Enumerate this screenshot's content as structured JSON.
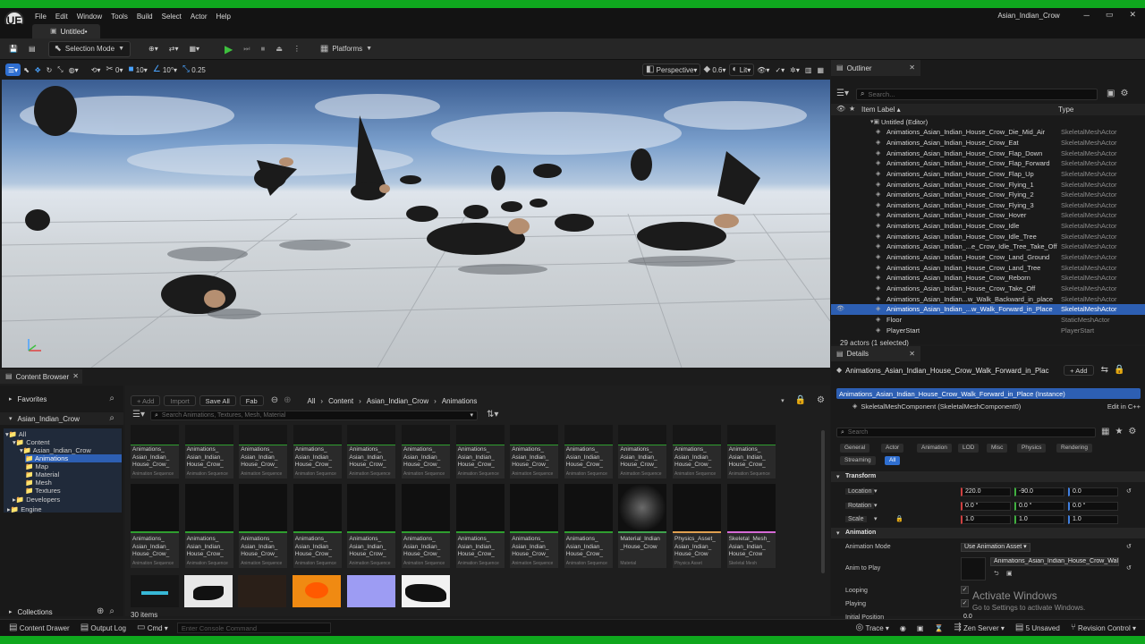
{
  "window": {
    "title": "Asian_Indian_Crow",
    "logo": "UE",
    "minimize": "─",
    "maximize": "▭",
    "close": "✕"
  },
  "menu": [
    "File",
    "Edit",
    "Window",
    "Tools",
    "Build",
    "Select",
    "Actor",
    "Help"
  ],
  "doc_tab": "Untitled•",
  "toolbar": {
    "selection_mode": "Selection Mode",
    "platforms": "Platforms"
  },
  "viewport_toolbar": {
    "rot_snap": "0",
    "grid_snap": "10",
    "angle_snap": "10°",
    "scale_snap": "0.25",
    "perspective": "Perspective",
    "fov": "0.6",
    "lit": "Lit"
  },
  "outliner": {
    "tab": "Outliner",
    "search_placeholder": "Search...",
    "col_label": "Item Label ▴",
    "col_type": "Type",
    "root": "Untitled (Editor)",
    "rows": [
      {
        "name": "Animations_Asian_Indian_House_Crow_Die_Mid_Air",
        "type": "SkeletalMeshActor"
      },
      {
        "name": "Animations_Asian_Indian_House_Crow_Eat",
        "type": "SkeletalMeshActor"
      },
      {
        "name": "Animations_Asian_Indian_House_Crow_Flap_Down",
        "type": "SkeletalMeshActor"
      },
      {
        "name": "Animations_Asian_Indian_House_Crow_Flap_Forward",
        "type": "SkeletalMeshActor"
      },
      {
        "name": "Animations_Asian_Indian_House_Crow_Flap_Up",
        "type": "SkeletalMeshActor"
      },
      {
        "name": "Animations_Asian_Indian_House_Crow_Flying_1",
        "type": "SkeletalMeshActor"
      },
      {
        "name": "Animations_Asian_Indian_House_Crow_Flying_2",
        "type": "SkeletalMeshActor"
      },
      {
        "name": "Animations_Asian_Indian_House_Crow_Flying_3",
        "type": "SkeletalMeshActor"
      },
      {
        "name": "Animations_Asian_Indian_House_Crow_Hover",
        "type": "SkeletalMeshActor"
      },
      {
        "name": "Animations_Asian_Indian_House_Crow_Idle",
        "type": "SkeletalMeshActor"
      },
      {
        "name": "Animations_Asian_Indian_House_Crow_Idle_Tree",
        "type": "SkeletalMeshActor"
      },
      {
        "name": "Animations_Asian_Indian_...e_Crow_Idle_Tree_Take_Off",
        "type": "SkeletalMeshActor"
      },
      {
        "name": "Animations_Asian_Indian_House_Crow_Land_Ground",
        "type": "SkeletalMeshActor"
      },
      {
        "name": "Animations_Asian_Indian_House_Crow_Land_Tree",
        "type": "SkeletalMeshActor"
      },
      {
        "name": "Animations_Asian_Indian_House_Crow_Reborn",
        "type": "SkeletalMeshActor"
      },
      {
        "name": "Animations_Asian_Indian_House_Crow_Take_Off",
        "type": "SkeletalMeshActor"
      },
      {
        "name": "Animations_Asian_Indian...w_Walk_Backward_in_place",
        "type": "SkeletalMeshActor"
      },
      {
        "name": "Animations_Asian_Indian_...w_Walk_Forward_in_Place",
        "type": "SkeletalMeshActor",
        "selected": true
      },
      {
        "name": "Floor",
        "type": "StaticMeshActor"
      },
      {
        "name": "PlayerStart",
        "type": "PlayerStart"
      }
    ],
    "footer": "29 actors (1 selected)"
  },
  "details": {
    "tab": "Details",
    "actor_name": "Animations_Asian_Indian_House_Crow_Walk_Forward_in_Plac",
    "add_label": "+ Add",
    "instance": "Animations_Asian_Indian_House_Crow_Walk_Forward_in_Place (Instance)",
    "component": "SkeletalMeshComponent (SkeletalMeshComponent0)",
    "edit_cpp": "Edit in C++",
    "search_placeholder": "Search",
    "categories": [
      "General",
      "Actor",
      "Animation",
      "LOD",
      "Misc",
      "Physics",
      "Rendering",
      "Streaming",
      "All"
    ],
    "transform": {
      "header": "Transform",
      "location_label": "Location",
      "location": [
        "220.0",
        "-90.0",
        "0.0"
      ],
      "rotation_label": "Rotation",
      "rotation": [
        "0.0 °",
        "0.0 °",
        "0.0 °"
      ],
      "scale_label": "Scale",
      "scale": [
        "1.0",
        "1.0",
        "1.0"
      ]
    },
    "animation": {
      "header": "Animation",
      "mode_label": "Animation Mode",
      "mode_value": "Use Animation Asset",
      "anim_label": "Anim to Play",
      "anim_value": "Animations_Asian_Indian_House_Crow_Wal",
      "looping_label": "Looping",
      "playing_label": "Playing",
      "initial_label": "Initial Position",
      "initial_value": "0.0"
    },
    "activate_title": "Activate Windows",
    "activate_sub": "Go to Settings to activate Windows."
  },
  "content_browser": {
    "tab": "Content Browser",
    "favorites": "Favorites",
    "project": "Asian_Indian_Crow",
    "add": "+ Add",
    "import": "Import",
    "save_all": "Save All",
    "fab": "Fab",
    "path": [
      "All",
      "Content",
      "Asian_Indian_Crow",
      "Animations"
    ],
    "search_placeholder": "Search Animations, Textures, Mesh, Material",
    "tree": [
      "All",
      "Content",
      "Asian_Indian_Crow",
      "Animations",
      "Map",
      "Material",
      "Mesh",
      "Textures",
      "Developers",
      "Engine"
    ],
    "collections": "Collections",
    "item_count": "30 items",
    "row1": [
      {
        "name": "Animations_ Asian_Indian_ House_Crow_",
        "type": "Animation Sequence"
      },
      {
        "name": "Animations_ Asian_Indian_ House_Crow_",
        "type": "Animation Sequence"
      },
      {
        "name": "Animations_ Asian_Indian_ House_Crow_",
        "type": "Animation Sequence"
      },
      {
        "name": "Animations_ Asian_Indian_ House_Crow_",
        "type": "Animation Sequence"
      },
      {
        "name": "Animations_ Asian_Indian_ House_Crow_",
        "type": "Animation Sequence"
      },
      {
        "name": "Animations_ Asian_Indian_ House_Crow_",
        "type": "Animation Sequence"
      },
      {
        "name": "Animations_ Asian_Indian_ House_Crow_",
        "type": "Animation Sequence"
      },
      {
        "name": "Animations_ Asian_Indian_ House_Crow_",
        "type": "Animation Sequence"
      },
      {
        "name": "Animations_ Asian_Indian_ House_Crow_",
        "type": "Animation Sequence"
      },
      {
        "name": "Animations_ Asian_Indian_ House_Crow_",
        "type": "Animation Sequence"
      },
      {
        "name": "Animations_ Asian_Indian_ House_Crow_",
        "type": "Animation Sequence"
      },
      {
        "name": "Animations_ Asian_Indian_ House_Crow_",
        "type": "Animation Sequence"
      }
    ],
    "row2": [
      {
        "name": "Animations_ Asian_Indian_ House_Crow_",
        "type": "Animation Sequence",
        "bar": "#2f9e2f"
      },
      {
        "name": "Animations_ Asian_Indian_ House_Crow_",
        "type": "Animation Sequence",
        "bar": "#2f9e2f"
      },
      {
        "name": "Animations_ Asian_Indian_ House_Crow_",
        "type": "Animation Sequence",
        "bar": "#2f9e2f"
      },
      {
        "name": "Animations_ Asian_Indian_ House_Crow_",
        "type": "Animation Sequence",
        "bar": "#2f9e2f"
      },
      {
        "name": "Animations_ Asian_Indian_ House_Crow_",
        "type": "Animation Sequence",
        "bar": "#2f9e2f"
      },
      {
        "name": "Animations_ Asian_Indian_ House_Crow_",
        "type": "Animation Sequence",
        "bar": "#2f9e2f"
      },
      {
        "name": "Animations_ Asian_Indian_ House_Crow_",
        "type": "Animation Sequence",
        "bar": "#2f9e2f"
      },
      {
        "name": "Animations_ Asian_Indian_ House_Crow_",
        "type": "Animation Sequence",
        "bar": "#2f9e2f"
      },
      {
        "name": "Animations_ Asian_Indian_ House_Crow_",
        "type": "Animation Sequence",
        "bar": "#2f9e2f"
      },
      {
        "name": "Material_Indian _House_Crow",
        "type": "Material",
        "bar": "#3fa34d"
      },
      {
        "name": "Physics_Asset_ Asian_Indian_ House_Crow",
        "type": "Physics Asset",
        "bar": "#e0a050"
      },
      {
        "name": "Skeletal_Mesh_ Asian_Indian_ House_Crow",
        "type": "Skeletal Mesh",
        "bar": "#d66ad6"
      }
    ]
  },
  "statusbar": {
    "content_drawer": "Content Drawer",
    "output_log": "Output Log",
    "cmd": "Cmd",
    "console_placeholder": "Enter Console Command",
    "trace": "Trace",
    "zen": "Zen Server",
    "unsaved": "5 Unsaved",
    "revision": "Revision Control"
  }
}
